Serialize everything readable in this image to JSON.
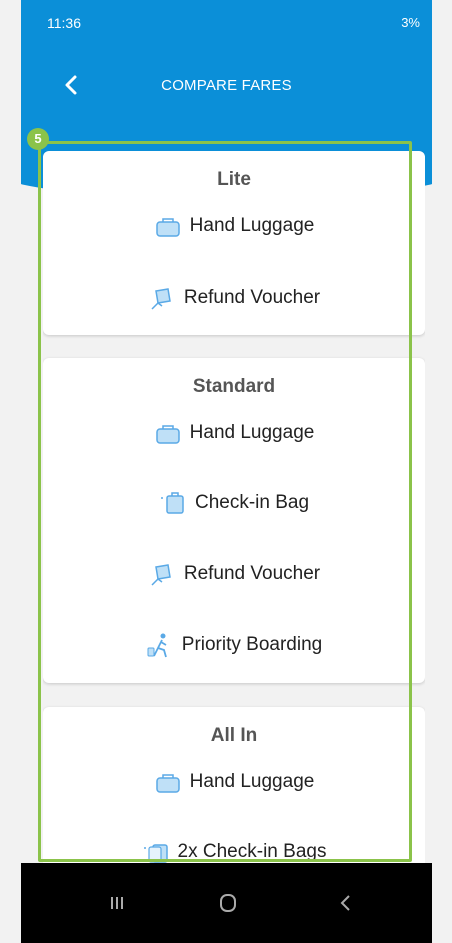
{
  "status": {
    "time": "11:36",
    "right": "3%"
  },
  "header": {
    "title": "COMPARE FARES"
  },
  "badge": "5",
  "cards": [
    {
      "title": "Lite",
      "features": [
        {
          "label": "Hand Luggage",
          "icon": "hand-luggage-icon"
        },
        {
          "label": "Refund Voucher",
          "icon": "refund-voucher-icon"
        }
      ]
    },
    {
      "title": "Standard",
      "features": [
        {
          "label": "Hand Luggage",
          "icon": "hand-luggage-icon"
        },
        {
          "label": "Check-in Bag",
          "icon": "check-in-bag-icon"
        },
        {
          "label": "Refund Voucher",
          "icon": "refund-voucher-icon"
        },
        {
          "label": "Priority Boarding",
          "icon": "priority-boarding-icon"
        }
      ]
    },
    {
      "title": "All In",
      "features": [
        {
          "label": "Hand Luggage",
          "icon": "hand-luggage-icon"
        },
        {
          "label": "2x Check-in Bags",
          "icon": "check-in-bags-icon"
        }
      ]
    }
  ],
  "colors": {
    "header": "#0b8fd8",
    "highlight": "#8bc34a",
    "icon": "#5aa9e6"
  }
}
